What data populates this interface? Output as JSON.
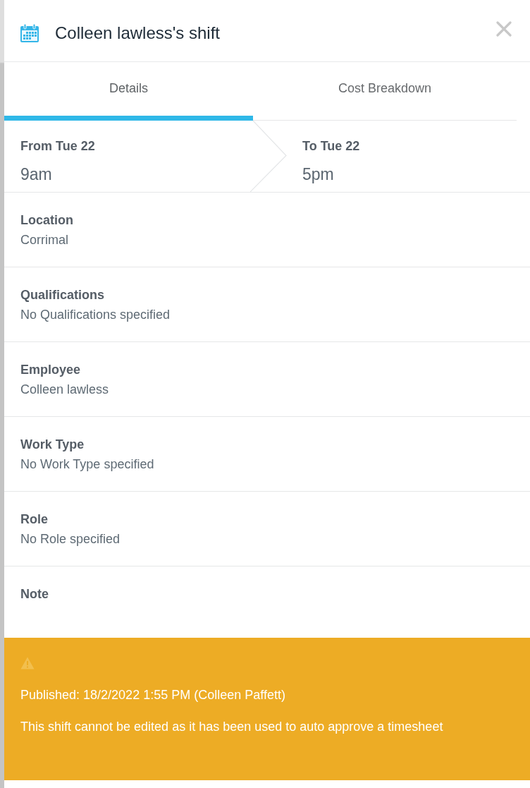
{
  "header": {
    "title": "Colleen lawless's shift"
  },
  "tabs": [
    {
      "label": "Details",
      "selected": true
    },
    {
      "label": "Cost Breakdown",
      "selected": false
    }
  ],
  "time_range": {
    "from": {
      "label": "From Tue 22",
      "value": "9am"
    },
    "to": {
      "label": "To Tue 22",
      "value": "5pm"
    }
  },
  "fields": [
    {
      "label": "Location",
      "value": "Corrimal"
    },
    {
      "label": "Qualifications",
      "value": "No Qualifications specified"
    },
    {
      "label": "Employee",
      "value": "Colleen lawless"
    },
    {
      "label": "Work Type",
      "value": "No Work Type specified"
    },
    {
      "label": "Role",
      "value": "No Role specified"
    },
    {
      "label": "Note"
    }
  ],
  "banner": {
    "lines": [
      "Published: 18/2/2022 1:55 PM (Colleen Paffett)",
      "This shift cannot be edited as it has been used to auto approve a timesheet"
    ]
  }
}
